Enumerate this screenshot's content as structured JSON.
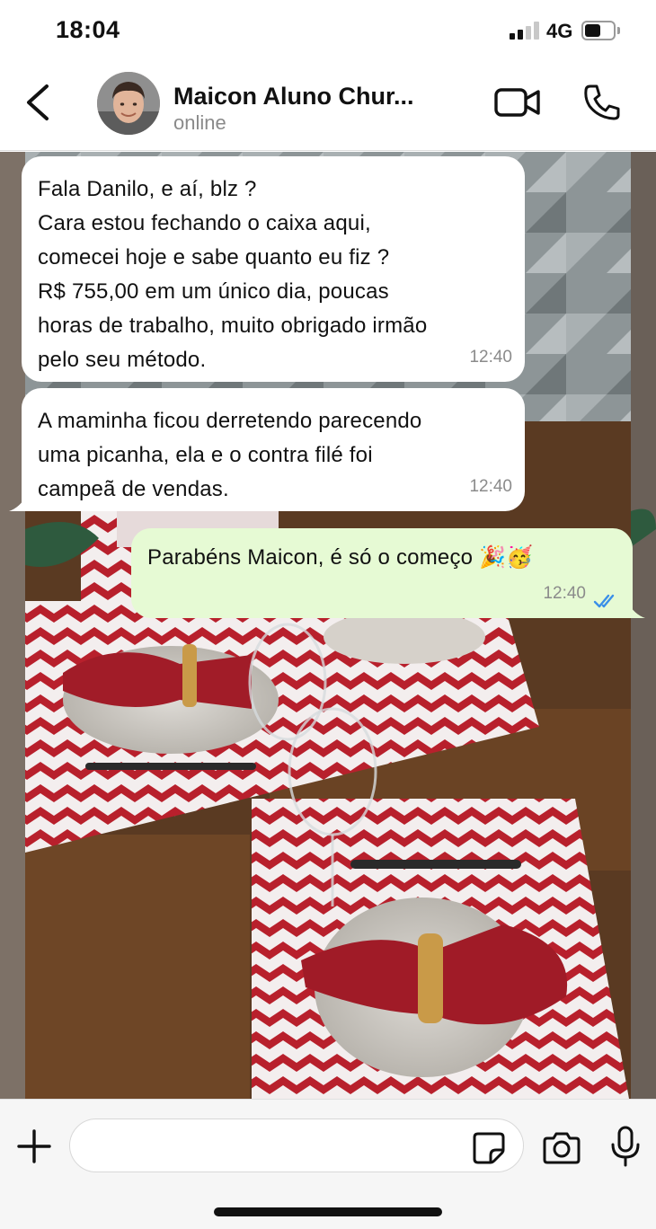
{
  "status_bar": {
    "time": "18:04",
    "network": "4G",
    "signal_bars": 2,
    "battery_level": 0.55
  },
  "header": {
    "contact_name": "Maicon Aluno Chur...",
    "contact_status": "online",
    "icons": [
      "back-icon",
      "video-call-icon",
      "phone-icon"
    ]
  },
  "messages": [
    {
      "direction": "incoming",
      "text": "Fala Danilo, e aí, blz ?\nCara estou fechando o caixa aqui,\ncomecei hoje e sabe quanto eu fiz ?\nR$ 755,00 em um único dia, poucas\nhoras de trabalho, muito obrigado irmão\npelo seu método.",
      "time": "12:40"
    },
    {
      "direction": "incoming",
      "text": "A maminha ficou derretendo parecendo\numa picanha, ela e o contra filé foi\ncampeã de vendas.",
      "time": "12:40"
    },
    {
      "direction": "outgoing",
      "text": "Parabéns Maicon, é só o começo 🎉🥳",
      "time": "12:40",
      "read_receipt": "double-check-read"
    }
  ],
  "input_bar": {
    "placeholder": ""
  },
  "colors": {
    "incoming_bubble": "#ffffff",
    "outgoing_bubble": "#e6fad4",
    "read_tick": "#3a8fe8",
    "time_gray": "#8b8b8b"
  }
}
